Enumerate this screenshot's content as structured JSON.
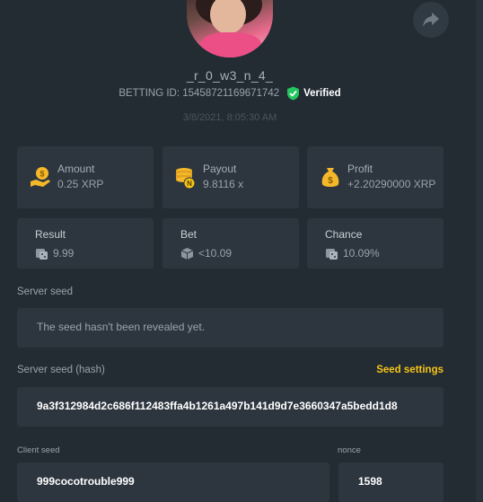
{
  "profile": {
    "username": "_r_0_w3_n_4_",
    "betting_id": "BETTING ID: 15458721169671742",
    "verified_label": "Verified",
    "date": "3/8/2021, 8:05:30 AM"
  },
  "stats": [
    {
      "label": "Amount",
      "value": "0.25 XRP",
      "icon": "coins-hand-icon"
    },
    {
      "label": "Payout",
      "value": "9.8116 x",
      "icon": "coin-stack-icon"
    },
    {
      "label": "Profit",
      "value": "+2.20290000 XRP",
      "icon": "money-bag-icon"
    }
  ],
  "details": [
    {
      "label": "Result",
      "value": "9.99",
      "icon": "dice-icon"
    },
    {
      "label": "Bet",
      "value": "<10.09",
      "icon": "cube-icon"
    },
    {
      "label": "Chance",
      "value": "10.09%",
      "icon": "dice-icon"
    }
  ],
  "server_seed": {
    "label": "Server seed",
    "value": "The seed hasn't been revealed yet."
  },
  "server_seed_hash": {
    "label": "Server seed (hash)",
    "settings_link": "Seed settings",
    "value": "9a3f312984d2c686f112483ffa4b1261a497b141d9d7e3660347a5bedd1d8"
  },
  "client_seed": {
    "label": "Client seed",
    "value": "999cocotrouble999"
  },
  "nonce": {
    "label": "nonce",
    "value": "1598"
  },
  "colors": {
    "background": "#232b33",
    "card": "#2d363f",
    "accent": "#f5c518",
    "verified": "#22c55e"
  }
}
